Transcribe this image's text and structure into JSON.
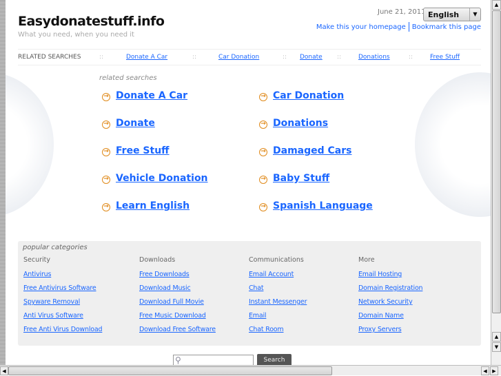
{
  "header": {
    "title": "Easydonatestuff.info",
    "tagline": "What you need, when you need it",
    "date": "June 21, 2011",
    "language": "English",
    "make_homepage": "Make this your homepage",
    "bookmark": "Bookmark this page"
  },
  "related_bar": {
    "label": "RELATED SEARCHES",
    "sep": "::",
    "links": [
      "Donate A Car",
      "Car Donation",
      "Donate",
      "Donations",
      "Free Stuff"
    ]
  },
  "related": {
    "heading": "related searches",
    "links": [
      "Donate A Car",
      "Car Donation",
      "Donate",
      "Donations",
      "Free Stuff",
      "Damaged Cars",
      "Vehicle Donation",
      "Baby Stuff",
      "Learn English",
      "Spanish Language"
    ]
  },
  "popular": {
    "heading": "popular categories",
    "columns": [
      {
        "title": "Security",
        "links": [
          "Antivirus",
          "Free Antivirus Software",
          "Spyware Removal",
          "Anti Virus Software",
          "Free Anti Virus Download"
        ]
      },
      {
        "title": "Downloads",
        "links": [
          "Free Downloads",
          "Download Music",
          "Download Full Movie",
          "Free Music Download",
          "Download Free Software"
        ]
      },
      {
        "title": "Communications",
        "links": [
          "Email Account",
          "Chat",
          "Instant Messenger",
          "Email",
          "Chat Room"
        ]
      },
      {
        "title": "More",
        "links": [
          "Email Hosting",
          "Domain Registration",
          "Network Security",
          "Domain Name",
          "Proxy Servers"
        ]
      }
    ]
  },
  "search": {
    "button": "Search",
    "value": ""
  }
}
